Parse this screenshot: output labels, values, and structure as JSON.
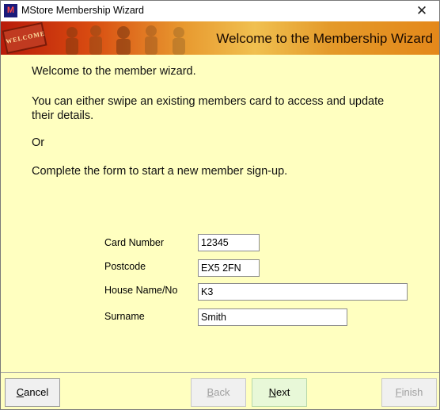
{
  "window": {
    "title": "MStore Membership Wizard",
    "icon_label": "M",
    "close_symbol": "✕"
  },
  "banner": {
    "mat_text": "WELCOME",
    "title": "Welcome to the Membership Wizard"
  },
  "content": {
    "intro": "Welcome to the member wizard.",
    "swipe_text": "You can either swipe an existing members card to access and update their details.",
    "or_text": "Or",
    "complete_text": "Complete the form to start a new member sign-up."
  },
  "form": {
    "card_number": {
      "label": "Card Number",
      "value": "12345"
    },
    "postcode": {
      "label": "Postcode",
      "value": "EX5 2FN"
    },
    "house": {
      "label": "House Name/No",
      "value": "K3"
    },
    "surname": {
      "label": "Surname",
      "value": "Smith"
    }
  },
  "buttons": {
    "cancel": {
      "first": "C",
      "rest": "ancel"
    },
    "back": {
      "first": "B",
      "rest": "ack"
    },
    "next": {
      "first": "N",
      "rest": "ext"
    },
    "finish": {
      "first": "F",
      "rest": "inish"
    }
  },
  "colors": {
    "background": "#ffffc0",
    "banner_start": "#b81a0a",
    "banner_end": "#e4881a",
    "next_button": "#e8f8d8"
  }
}
